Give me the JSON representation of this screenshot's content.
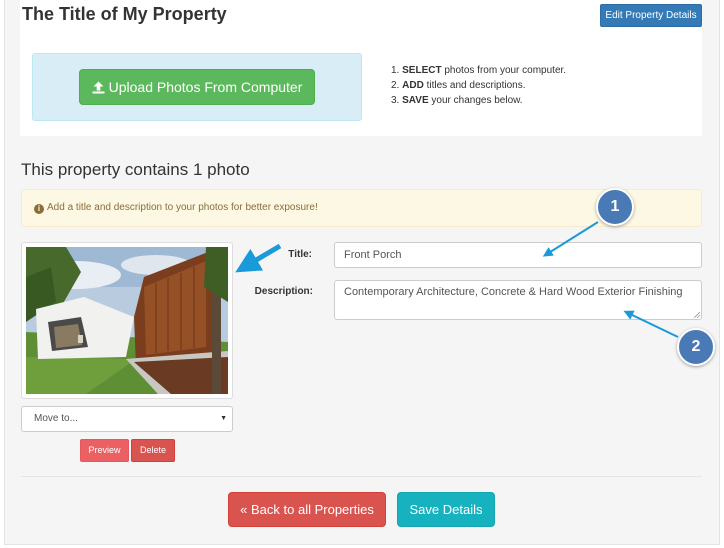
{
  "header": {
    "title": "The Title of My Property",
    "edit_button_label": "Edit Property Details"
  },
  "upload": {
    "button_label": "Upload Photos From Computer",
    "button_icon": "upload-icon",
    "steps": [
      {
        "num": "1.",
        "strong": "SELECT",
        "rest": " photos from your computer."
      },
      {
        "num": "2.",
        "strong": "ADD",
        "rest": " titles and descriptions."
      },
      {
        "num": "3.",
        "strong": "SAVE",
        "rest": " your changes below."
      }
    ]
  },
  "gallery": {
    "heading": "This property contains 1 photo",
    "alert_icon": "info-circle-icon",
    "alert_text": "Add a title and description to your photos for better exposure!"
  },
  "photo": {
    "move_select_value": "Move to...",
    "preview_label": "Preview",
    "delete_label": "Delete",
    "title_label": "Title:",
    "title_value": "Front Porch",
    "description_label": "Description:",
    "description_value": "Contemporary Architecture, Concrete & Hard Wood Exterior Finishing"
  },
  "footer": {
    "back_label": "« Back to all Properties",
    "save_label": "Save Details"
  },
  "callouts": {
    "one": "1",
    "two": "2"
  },
  "colors": {
    "primary": "#337ab7",
    "success": "#5cb85c",
    "danger": "#d9534f",
    "info": "#17b2bf",
    "callout": "#4a7ab5",
    "arrow": "#1a9ad9"
  }
}
